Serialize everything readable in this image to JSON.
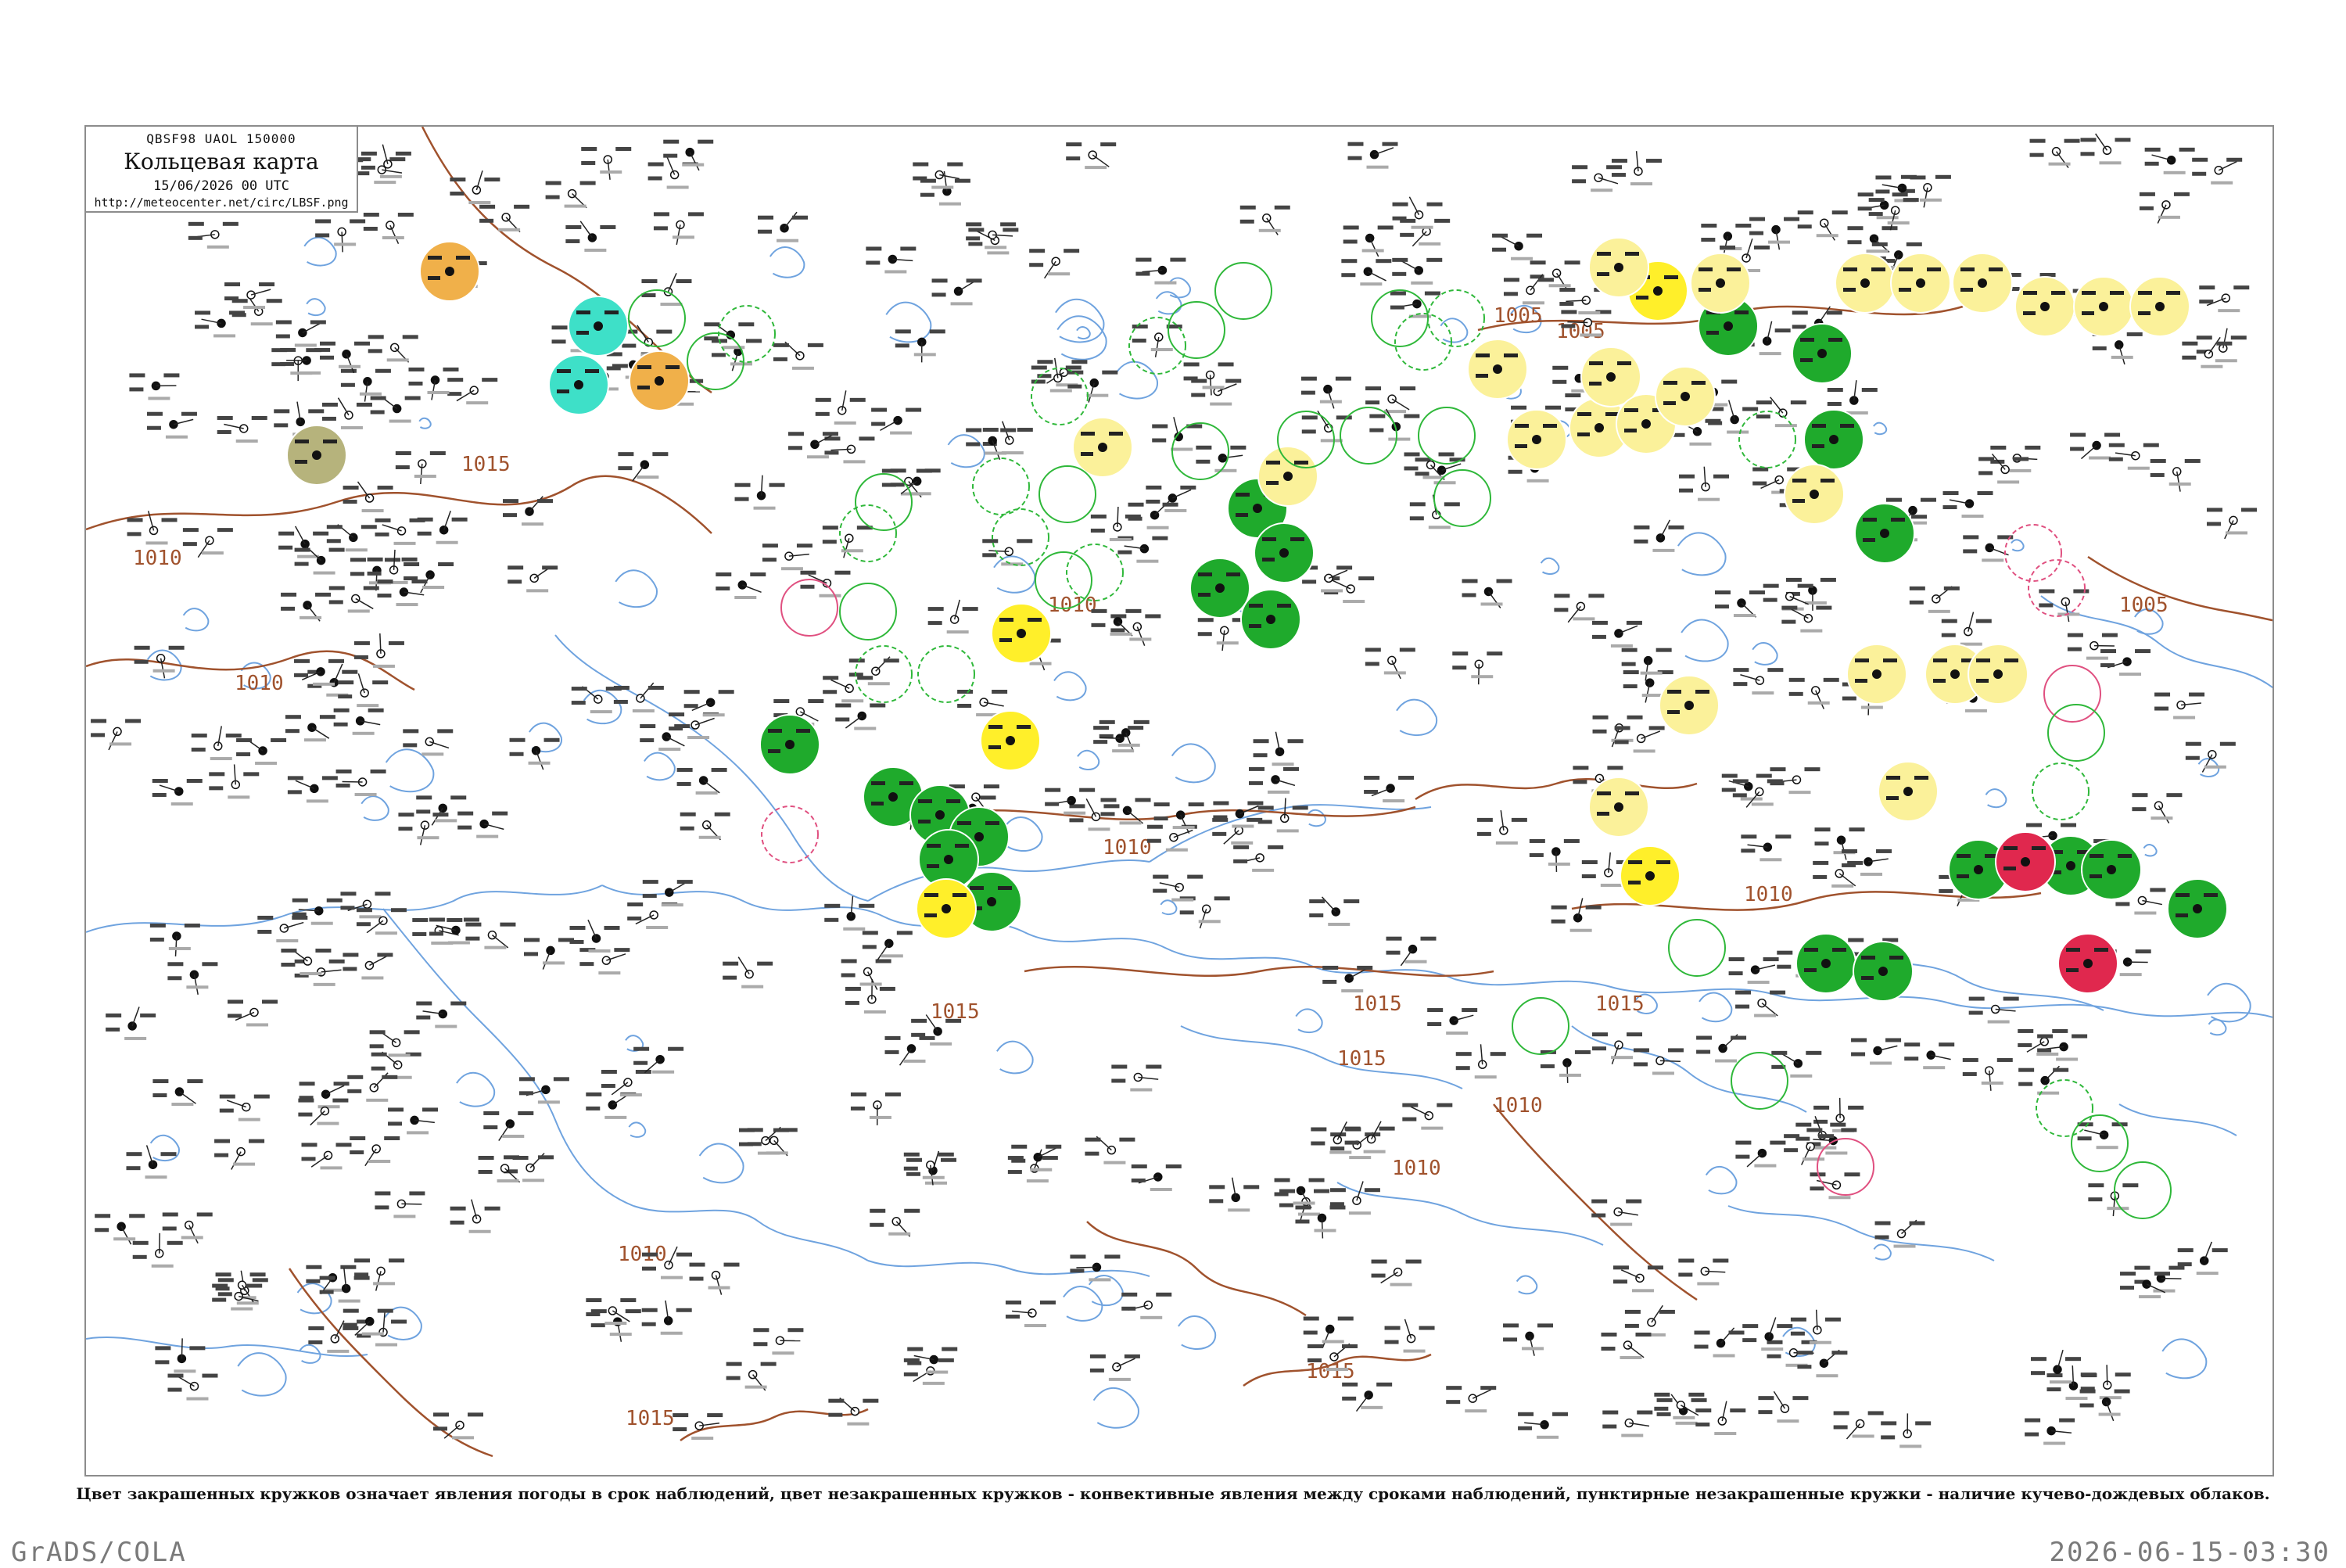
{
  "title_box": {
    "code": "QBSF98  UAOL  150000",
    "name": "Кольцевая карта",
    "date": "15/06/2026 00 UTC",
    "url": "http://meteocenter.net/circ/LBSF.png"
  },
  "isobar_labels": [
    "1010",
    "1015",
    "1010",
    "1010",
    "1005",
    "1015",
    "1015",
    "1010",
    "1015",
    "1010",
    "1010",
    "1005",
    "1010",
    "1015",
    "1010",
    "1015",
    "1005",
    "1015"
  ],
  "colors": {
    "coast": "#6fa3df",
    "isobar": "#a0522d",
    "frame": "#8c8c8c",
    "green": "#1faa2c",
    "yellow": "#ffef2a",
    "pale_yellow": "#fbf19a",
    "orange": "#f0b04a",
    "cyan": "#3ee0c8",
    "red": "#e0284e",
    "olive": "#b6b37c",
    "ring_green": "#2fb83a",
    "ring_red": "#e05080"
  },
  "caption": "Цвет закрашенных кружков означает явления погоды в срок наблюдений, цвет незакрашенных кружков - конвективные явления между сроками наблюдений, пунктирные незакрашенные кружки - наличие кучево-дождевых облаков.",
  "footer": {
    "left": "GrADS/COLA",
    "right": "2026-06-15-03:30"
  }
}
